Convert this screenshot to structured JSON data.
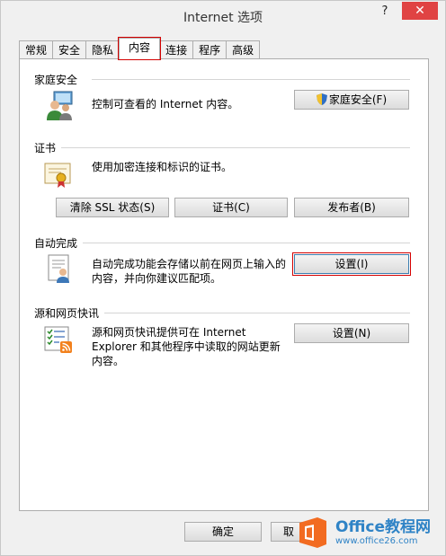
{
  "window": {
    "title": "Internet 选项",
    "help": "?",
    "close": "✕"
  },
  "tabs": [
    "常规",
    "安全",
    "隐私",
    "内容",
    "连接",
    "程序",
    "高级"
  ],
  "active_tab": "内容",
  "sections": {
    "family": {
      "heading": "家庭安全",
      "description": "控制可查看的 Internet 内容。",
      "button": "家庭安全(F)"
    },
    "certs": {
      "heading": "证书",
      "description": "使用加密连接和标识的证书。",
      "buttons": [
        "清除 SSL 状态(S)",
        "证书(C)",
        "发布者(B)"
      ]
    },
    "autocomplete": {
      "heading": "自动完成",
      "description_line1": "自动完成功能会存储以前在网页上输入的",
      "description_line2": "内容，并向你建议匹配项。",
      "button": "设置(I)"
    },
    "feeds": {
      "heading": "源和网页快讯",
      "description_line1": "源和网页快讯提供可在 Internet",
      "description_line2": "Explorer 和其他程序中读取的网站更新",
      "description_line3": "内容。",
      "button": "设置(N)"
    }
  },
  "footer": {
    "ok": "确定",
    "cancel": "取"
  },
  "watermark": {
    "brand": "Office教程网",
    "url": "www.office26.com"
  },
  "colors": {
    "close_bg": "#e04343",
    "highlight": "#d40000",
    "brand": "#2f83c6",
    "logo_orange": "#f26b21"
  }
}
